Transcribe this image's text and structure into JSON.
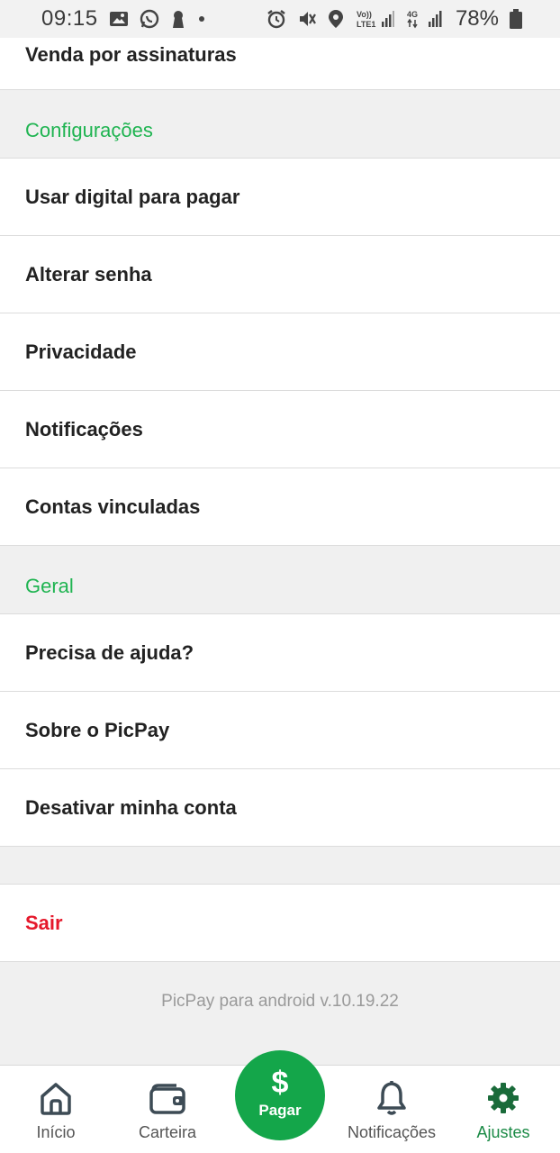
{
  "status_bar": {
    "time": "09:15",
    "battery_percent": "78%",
    "left_icons": [
      "gallery-icon",
      "whatsapp-icon",
      "keyhole-icon",
      "dot-icon"
    ],
    "right_icons": [
      "alarm-icon",
      "vibrate-icon",
      "location-icon",
      "volte-icon",
      "signal-icon",
      "4g-icon",
      "signal-icon",
      "battery-icon"
    ],
    "volte_text": "Vo)) LTE1",
    "network_text": "4G"
  },
  "menu": {
    "top_item": "Venda por assinaturas",
    "configuracoes": {
      "header": "Configurações",
      "items": [
        "Usar digital para pagar",
        "Alterar senha",
        "Privacidade",
        "Notificações",
        "Contas vinculadas"
      ]
    },
    "geral": {
      "header": "Geral",
      "items": [
        "Precisa de ajuda?",
        "Sobre o PicPay",
        "Desativar minha conta"
      ]
    },
    "logout": "Sair",
    "version": "PicPay para android v.10.19.22"
  },
  "bottom_nav": {
    "items": [
      {
        "label": "Início",
        "icon": "home-icon"
      },
      {
        "label": "Carteira",
        "icon": "wallet-icon"
      },
      {
        "label": "Notificações",
        "icon": "bell-icon"
      },
      {
        "label": "Ajustes",
        "icon": "gear-icon"
      }
    ],
    "pay": {
      "symbol": "$",
      "label": "Pagar"
    },
    "active": "Ajustes"
  },
  "colors": {
    "accent_green": "#1fb451",
    "pay_button": "#14a64a",
    "logout_red": "#e5182b",
    "active_tab": "#1a8a45"
  }
}
